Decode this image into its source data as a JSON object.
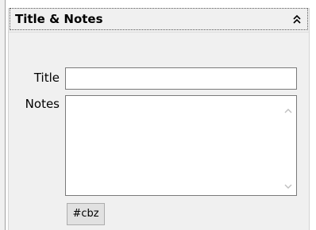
{
  "panel": {
    "title": "Title & Notes"
  },
  "form": {
    "title_label": "Title",
    "title_value": "",
    "notes_label": "Notes",
    "notes_value": ""
  },
  "tag_button": {
    "label": "#cbz"
  },
  "icons": {
    "collapse": "double-chevron-up-icon",
    "scroll_up": "chevron-up-icon",
    "scroll_down": "chevron-down-icon"
  }
}
